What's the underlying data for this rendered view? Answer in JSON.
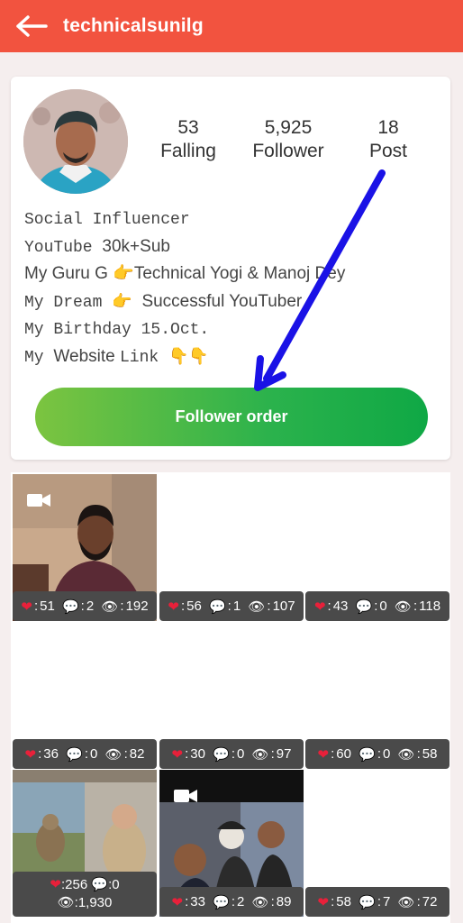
{
  "header": {
    "title": "technicalsunilg"
  },
  "profile": {
    "stats": [
      {
        "value": "53",
        "label": "Falling"
      },
      {
        "value": "5,925",
        "label": "Follower"
      },
      {
        "value": "18",
        "label": "Post"
      }
    ],
    "bio": [
      {
        "parts": [
          {
            "text": "Social Influencer",
            "font": "mono"
          }
        ]
      },
      {
        "parts": [
          {
            "text": "YouTube ",
            "font": "mono"
          },
          {
            "text": "30k+Sub",
            "font": "sans"
          }
        ]
      },
      {
        "parts": [
          {
            "text": "My Guru G 👉Technical Yogi & Manoj Dey",
            "font": "sans"
          }
        ]
      },
      {
        "parts": [
          {
            "text": "My Dream 👉 ",
            "font": "mono"
          },
          {
            "text": "Successful YouTuber",
            "font": "sans"
          }
        ]
      },
      {
        "parts": [
          {
            "text": "My Birthday 15.Oct.",
            "font": "mono"
          }
        ]
      },
      {
        "parts": [
          {
            "text": " My ",
            "font": "mono"
          },
          {
            "text": "Website ",
            "font": "sans"
          },
          {
            "text": "Link 👇👇",
            "font": "mono"
          }
        ]
      }
    ],
    "action_button": "Follower order"
  },
  "posts": [
    {
      "likes": "51",
      "comments": "2",
      "views": "192",
      "has_video": true,
      "thumb": "man-red-shirt"
    },
    {
      "likes": "56",
      "comments": "1",
      "views": "107",
      "has_video": false,
      "thumb": "blank"
    },
    {
      "likes": "43",
      "comments": "0",
      "views": "118",
      "has_video": false,
      "thumb": "blank"
    },
    {
      "likes": "36",
      "comments": "0",
      "views": "82",
      "has_video": false,
      "thumb": "blank"
    },
    {
      "likes": "30",
      "comments": "0",
      "views": "97",
      "has_video": false,
      "thumb": "blank"
    },
    {
      "likes": "60",
      "comments": "0",
      "views": "58",
      "has_video": false,
      "thumb": "blank"
    },
    {
      "likes": "256",
      "comments": "0",
      "views": "1,930",
      "has_video": false,
      "thumb": "monkeys"
    },
    {
      "likes": "33",
      "comments": "2",
      "views": "89",
      "has_video": true,
      "thumb": "group-selfie"
    },
    {
      "likes": "58",
      "comments": "7",
      "views": "72",
      "has_video": false,
      "thumb": "blank"
    }
  ],
  "icons": {
    "like": "heart-icon",
    "comment": "comment-icon",
    "view": "eye-icon",
    "video": "video-camera-icon",
    "back": "back-arrow-icon"
  },
  "colors": {
    "header": "#f2533f",
    "button_start": "#7cc440",
    "button_end": "#0fa845",
    "annotation_arrow": "#1010e0",
    "pill": "#4a4a4a"
  }
}
